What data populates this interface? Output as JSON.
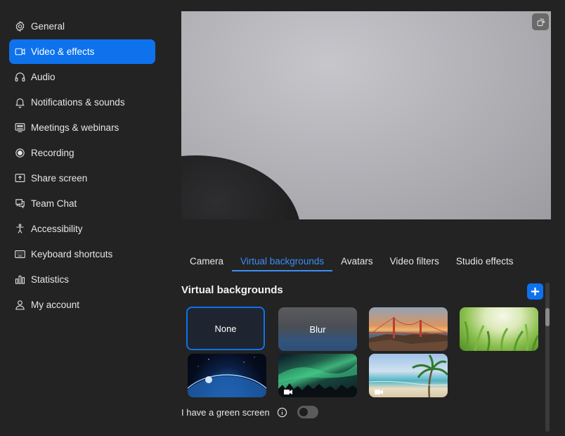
{
  "sidebar": {
    "items": [
      {
        "label": "General",
        "icon": "gear-icon"
      },
      {
        "label": "Video & effects",
        "icon": "video-camera-icon",
        "active": true
      },
      {
        "label": "Audio",
        "icon": "headphones-icon"
      },
      {
        "label": "Notifications & sounds",
        "icon": "bell-icon"
      },
      {
        "label": "Meetings & webinars",
        "icon": "meetings-icon"
      },
      {
        "label": "Recording",
        "icon": "record-icon"
      },
      {
        "label": "Share screen",
        "icon": "share-screen-icon"
      },
      {
        "label": "Team Chat",
        "icon": "chat-icon"
      },
      {
        "label": "Accessibility",
        "icon": "accessibility-icon"
      },
      {
        "label": "Keyboard shortcuts",
        "icon": "keyboard-icon"
      },
      {
        "label": "Statistics",
        "icon": "bar-chart-icon"
      },
      {
        "label": "My account",
        "icon": "user-icon"
      }
    ]
  },
  "tabs": [
    {
      "label": "Camera"
    },
    {
      "label": "Virtual backgrounds",
      "active": true
    },
    {
      "label": "Avatars"
    },
    {
      "label": "Video filters"
    },
    {
      "label": "Studio effects"
    }
  ],
  "virtual_backgrounds": {
    "title": "Virtual backgrounds",
    "none_label": "None",
    "blur_label": "Blur",
    "items": [
      "golden-gate-bridge",
      "grass",
      "earth-from-space",
      "aurora",
      "beach"
    ],
    "selected": "None"
  },
  "green_screen": {
    "label": "I have a green screen",
    "enabled": false
  },
  "colors": {
    "accent": "#0e72ed",
    "background": "#232323",
    "tab_active": "#3d8ef7"
  }
}
